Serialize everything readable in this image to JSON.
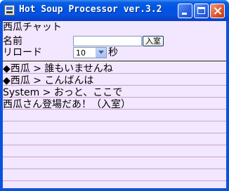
{
  "window": {
    "title": "Hot Soup Processor ver.3.2",
    "colors": {
      "titlebar": "#0054e3",
      "client_bg": "#f3e6ff",
      "ruled_line": "#c2a6c8"
    }
  },
  "app": {
    "heading": "西瓜チャット",
    "name_label": "名前",
    "name_value": "",
    "enter_button": "入室",
    "reload_label": "リロード",
    "reload_interval": "10",
    "reload_unit": "秒"
  },
  "log": [
    "◆西瓜 > 誰もいませんね",
    "◆西瓜 > こんばんは",
    "System > おっと、ここで",
    "西瓜さん登場だあ！（入室）"
  ]
}
